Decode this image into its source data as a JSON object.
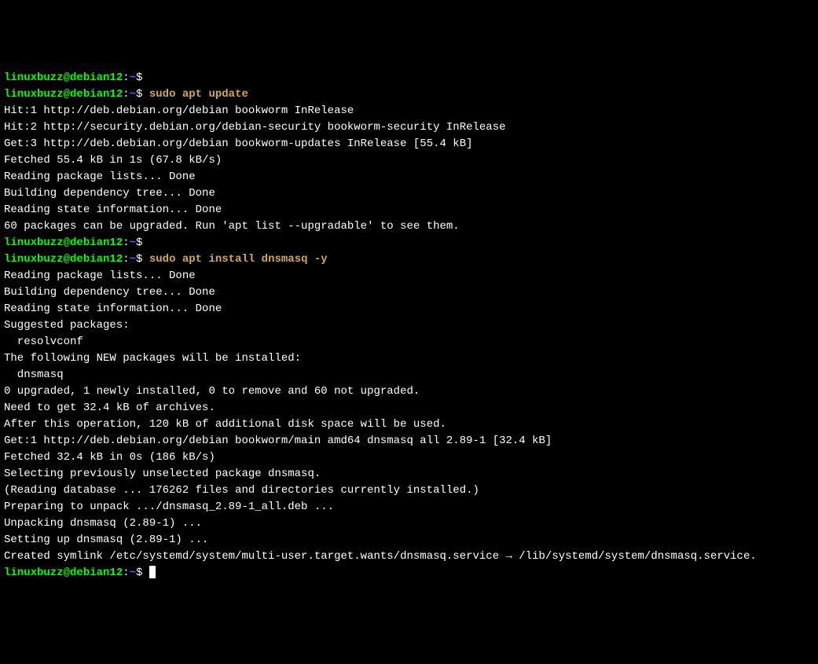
{
  "prompts": [
    {
      "user": "linuxbuzz@debian12",
      "sep": ":",
      "path": "~",
      "dollar": "$ ",
      "command": ""
    },
    {
      "user": "linuxbuzz@debian12",
      "sep": ":",
      "path": "~",
      "dollar": "$ ",
      "command": "sudo apt update"
    }
  ],
  "output1": [
    "Hit:1 http://deb.debian.org/debian bookworm InRelease",
    "Hit:2 http://security.debian.org/debian-security bookworm-security InRelease",
    "Get:3 http://deb.debian.org/debian bookworm-updates InRelease [55.4 kB]",
    "Fetched 55.4 kB in 1s (67.8 kB/s)",
    "Reading package lists... Done",
    "Building dependency tree... Done",
    "Reading state information... Done",
    "60 packages can be upgraded. Run 'apt list --upgradable' to see them."
  ],
  "prompts2": [
    {
      "user": "linuxbuzz@debian12",
      "sep": ":",
      "path": "~",
      "dollar": "$ ",
      "command": ""
    },
    {
      "user": "linuxbuzz@debian12",
      "sep": ":",
      "path": "~",
      "dollar": "$ ",
      "command": "sudo apt install dnsmasq -y"
    }
  ],
  "output2": [
    "Reading package lists... Done",
    "Building dependency tree... Done",
    "Reading state information... Done",
    "Suggested packages:",
    "  resolvconf",
    "The following NEW packages will be installed:",
    "  dnsmasq",
    "0 upgraded, 1 newly installed, 0 to remove and 60 not upgraded.",
    "Need to get 32.4 kB of archives.",
    "After this operation, 120 kB of additional disk space will be used.",
    "Get:1 http://deb.debian.org/debian bookworm/main amd64 dnsmasq all 2.89-1 [32.4 kB]",
    "Fetched 32.4 kB in 0s (186 kB/s)",
    "Selecting previously unselected package dnsmasq.",
    "(Reading database ... 176262 files and directories currently installed.)",
    "Preparing to unpack .../dnsmasq_2.89-1_all.deb ...",
    "Unpacking dnsmasq (2.89-1) ...",
    "Setting up dnsmasq (2.89-1) ...",
    "Created symlink /etc/systemd/system/multi-user.target.wants/dnsmasq.service → /lib/systemd/system/dnsmasq.service."
  ],
  "prompt3": {
    "user": "linuxbuzz@debian12",
    "sep": ":",
    "path": "~",
    "dollar": "$ "
  }
}
